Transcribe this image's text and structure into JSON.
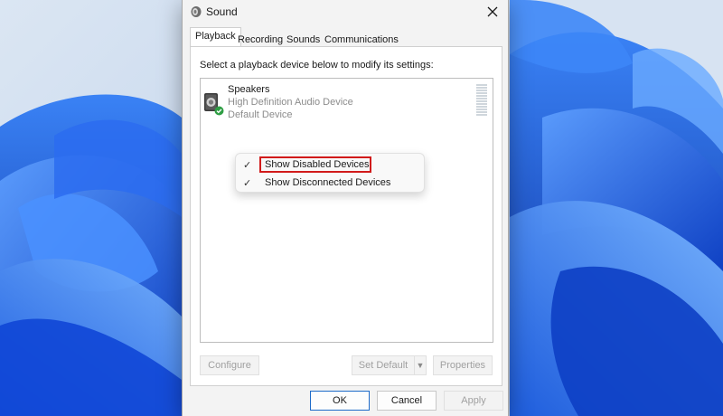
{
  "dialog": {
    "title": "Sound",
    "tabs": [
      {
        "label": "Playback",
        "active": true
      },
      {
        "label": "Recording",
        "active": false
      },
      {
        "label": "Sounds",
        "active": false
      },
      {
        "label": "Communications",
        "active": false
      }
    ],
    "instruction": "Select a playback device below to modify its settings:",
    "device": {
      "name": "Speakers",
      "description": "High Definition Audio Device",
      "status": "Default Device"
    },
    "context_menu": {
      "items": [
        {
          "label": "Show Disabled Devices",
          "checked": true,
          "highlighted": true
        },
        {
          "label": "Show Disconnected Devices",
          "checked": true,
          "highlighted": false
        }
      ],
      "check_glyph": "✓"
    },
    "panel_buttons": {
      "configure": "Configure",
      "set_default": "Set Default",
      "properties": "Properties"
    },
    "footer_buttons": {
      "ok": "OK",
      "cancel": "Cancel",
      "apply": "Apply"
    }
  },
  "colors": {
    "accent": "#1e6bc9",
    "highlight_border": "#d11a1a",
    "status_ok": "#2f9e44",
    "wallpaper_blue": "#1f5fe0"
  },
  "icons": {
    "app": "speaker-icon",
    "close": "close-icon",
    "device": "speaker-device-icon",
    "device_status": "check-badge-icon"
  }
}
